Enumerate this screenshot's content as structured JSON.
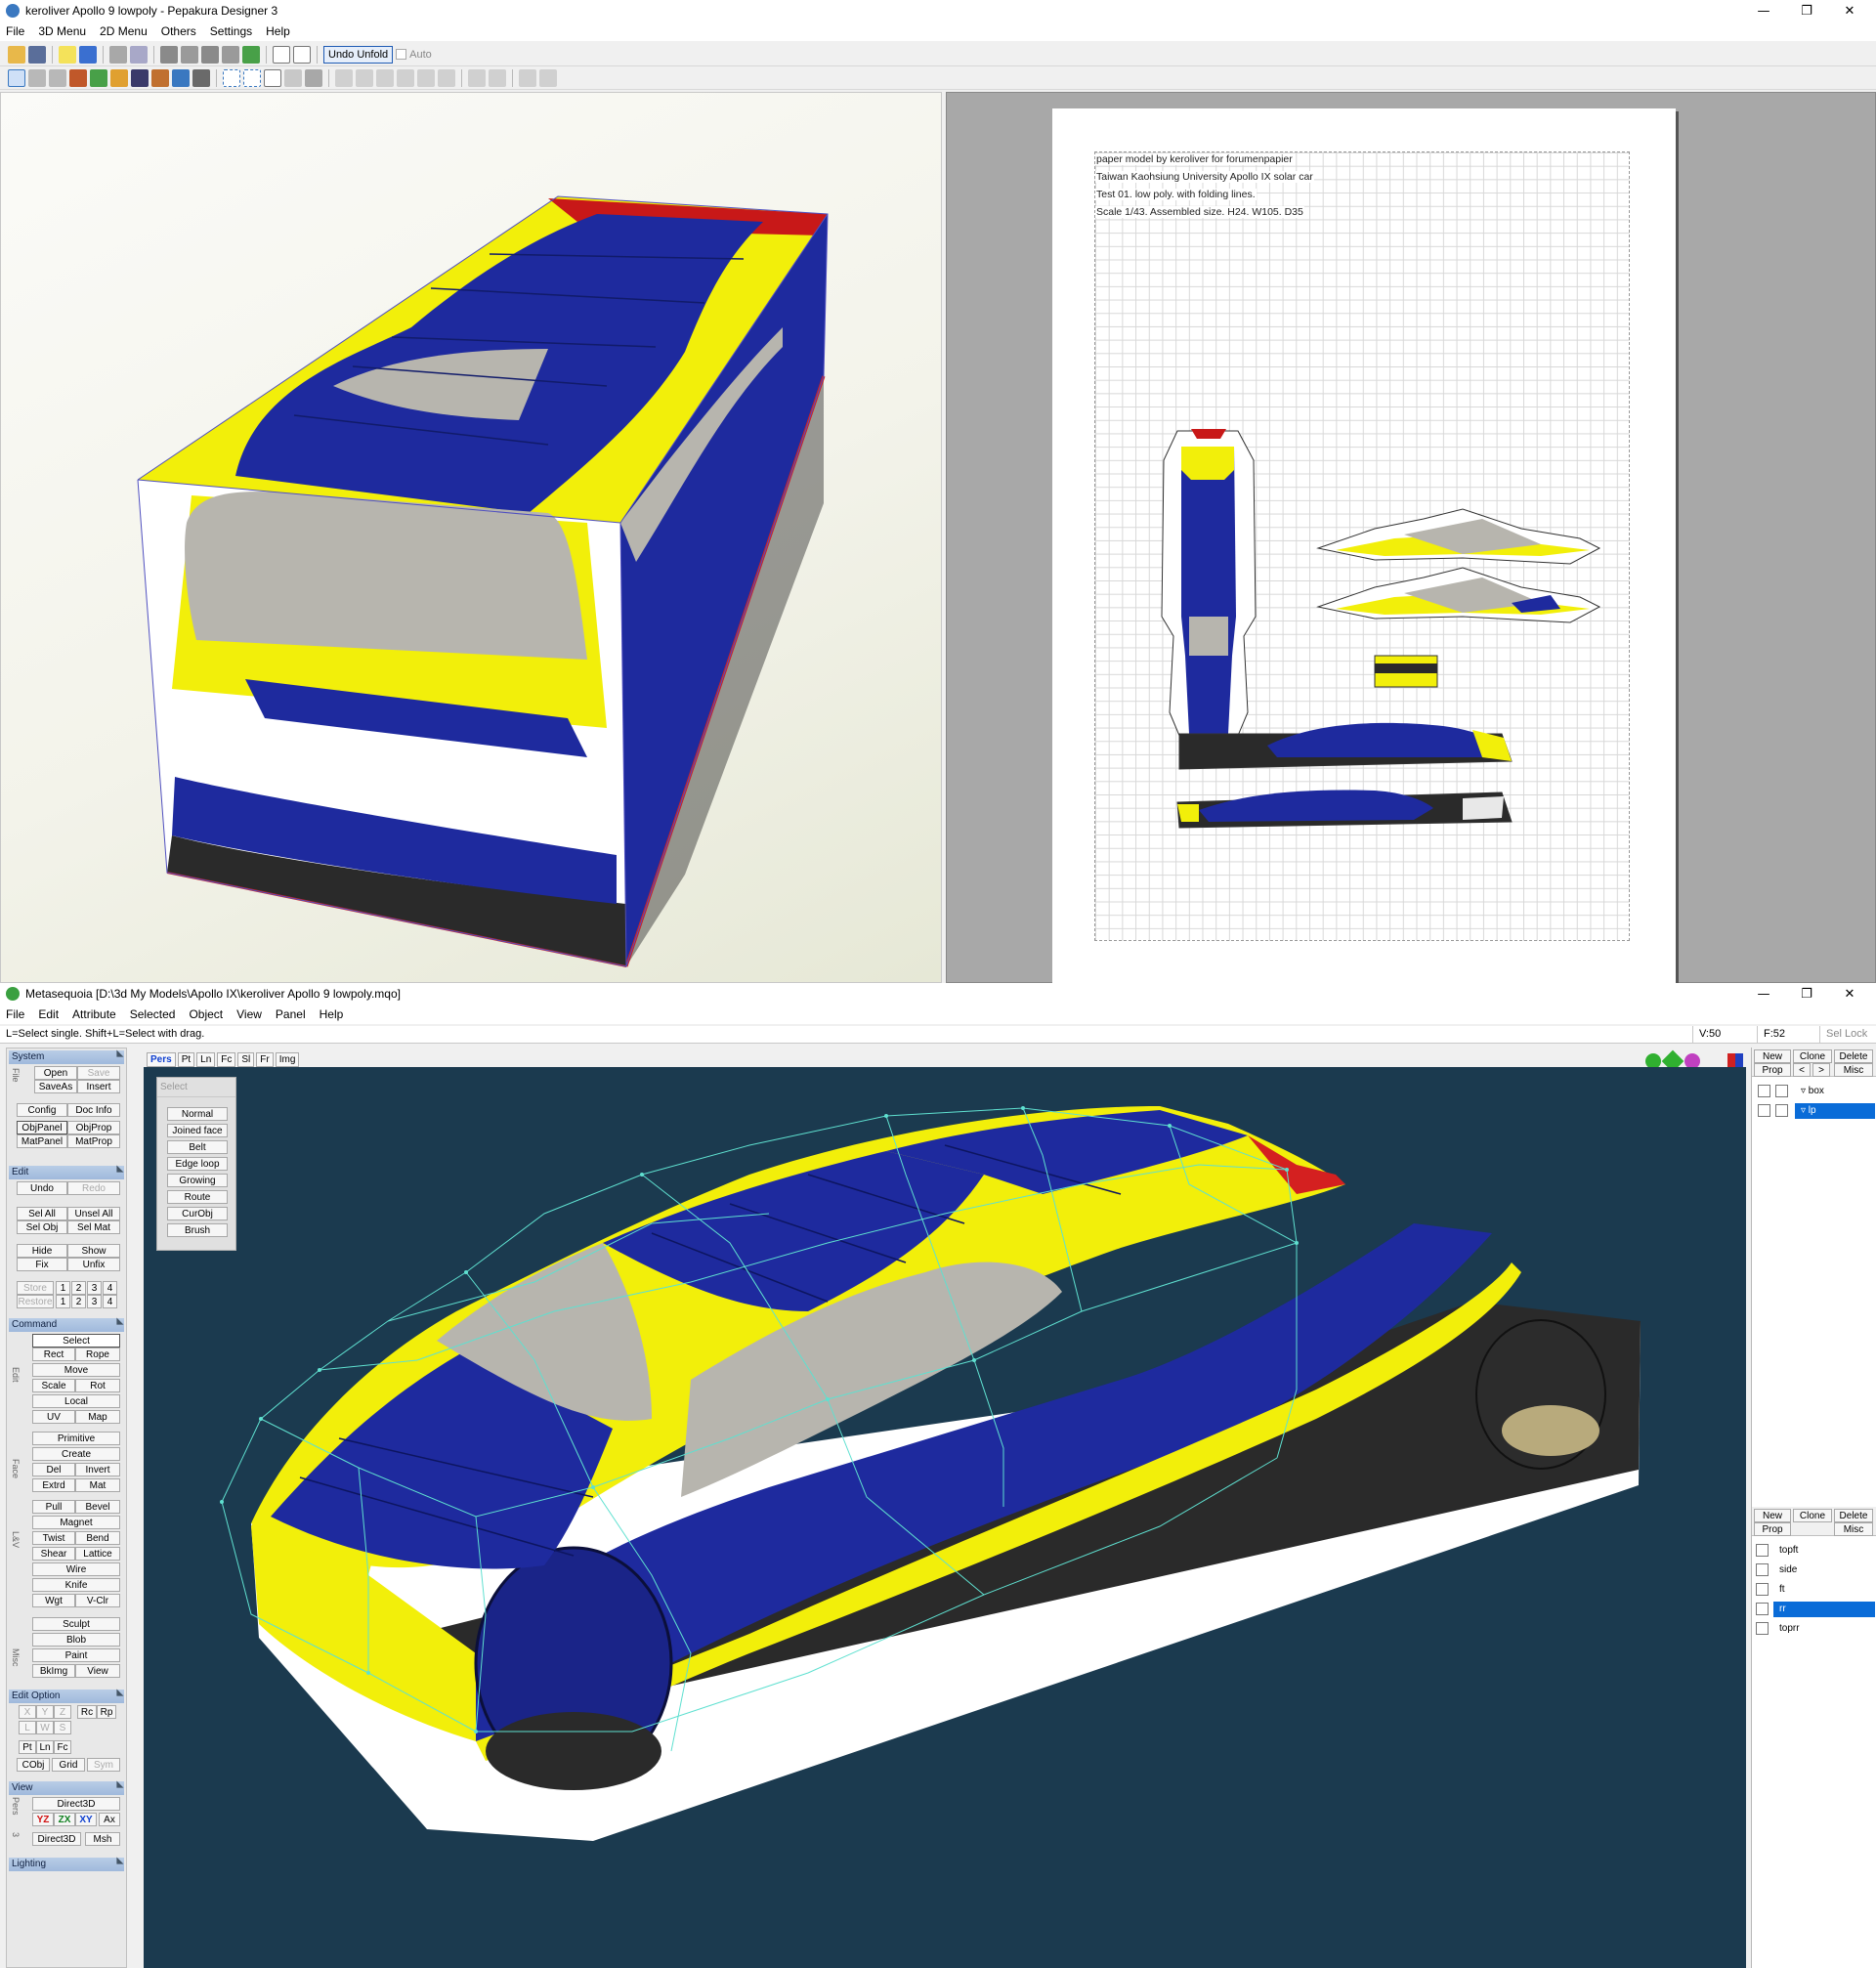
{
  "pepakura": {
    "title": "keroliver Apollo 9 lowpoly - Pepakura Designer 3",
    "menu": [
      "File",
      "3D Menu",
      "2D Menu",
      "Others",
      "Settings",
      "Help"
    ],
    "undo_unfold": "Undo Unfold",
    "auto_label": "Auto",
    "paper_text": [
      "paper model by keroliver for forumenpapier",
      "Taiwan Kaohsiung University Apollo IX solar car",
      "Test 01. low poly. with folding lines.",
      "Scale 1/43. Assembled size. H24. W105. D35"
    ]
  },
  "metasequoia": {
    "title": "Metasequoia [D:\\3d My Models\\Apollo IX\\keroliver Apollo 9 lowpoly.mqo]",
    "menu": [
      "File",
      "Edit",
      "Attribute",
      "Selected",
      "Object",
      "View",
      "Panel",
      "Help"
    ],
    "hint": "L=Select single.  Shift+L=Select with drag.",
    "v_count": "V:50",
    "f_count": "F:52",
    "sel_lock": "Sel Lock",
    "view_tabs": [
      "Pers",
      "Pt",
      "Ln",
      "Fc",
      "Sl",
      "Fr",
      "Img"
    ],
    "select_panel": {
      "title": "Select",
      "items": [
        "Normal",
        "Joined face",
        "Belt",
        "Edge loop",
        "Growing",
        "Route",
        "CurObj",
        "Brush"
      ]
    },
    "sections": {
      "system": "System",
      "edit": "Edit",
      "command": "Command",
      "edit_option": "Edit Option",
      "view": "View",
      "lighting": "Lighting"
    },
    "side_labels": {
      "file": "File",
      "edit": "Edit",
      "face": "Face",
      "lv": "L&V",
      "misc": "Misc",
      "pers": "Pers"
    },
    "system_buttons": {
      "open": "Open",
      "save": "Save",
      "saveas": "SaveAs",
      "insert": "Insert",
      "config": "Config",
      "docinfo": "Doc Info",
      "objpanel": "ObjPanel",
      "objprop": "ObjProp",
      "matpanel": "MatPanel",
      "matprop": "MatProp"
    },
    "edit_buttons": {
      "undo": "Undo",
      "redo": "Redo",
      "selall": "Sel All",
      "unselall": "Unsel All",
      "selobj": "Sel Obj",
      "selmat": "Sel Mat",
      "hide": "Hide",
      "show": "Show",
      "fix": "Fix",
      "unfix": "Unfix",
      "store": "Store",
      "restore": "Restore",
      "n1": "1",
      "n2": "2",
      "n3": "3",
      "n4": "4"
    },
    "command_buttons": {
      "select": "Select",
      "rect": "Rect",
      "rope": "Rope",
      "move": "Move",
      "scale": "Scale",
      "rot": "Rot",
      "local": "Local",
      "uv": "UV",
      "map": "Map",
      "primitive": "Primitive",
      "create": "Create",
      "del": "Del",
      "invert": "Invert",
      "extrd": "Extrd",
      "mat": "Mat",
      "pull": "Pull",
      "bevel": "Bevel",
      "magnet": "Magnet",
      "twist": "Twist",
      "bend": "Bend",
      "shear": "Shear",
      "lattice": "Lattice",
      "wire": "Wire",
      "knife": "Knife",
      "wgt": "Wgt",
      "vclr": "V-Clr",
      "sculpt": "Sculpt",
      "blob": "Blob",
      "paint": "Paint",
      "bkimg": "BkImg",
      "view": "View"
    },
    "option_buttons": {
      "x": "X",
      "y": "Y",
      "z": "Z",
      "rc": "Rc",
      "rp": "Rp",
      "l": "L",
      "w": "W",
      "s": "S",
      "pt": "Pt",
      "ln": "Ln",
      "fc": "Fc",
      "cobj": "CObj",
      "grid": "Grid",
      "sym": "Sym"
    },
    "view_buttons": {
      "direct3d": "Direct3D",
      "yz": "YZ",
      "zx": "ZX",
      "xy": "XY",
      "ax": "Ax",
      "direct3d2": "Direct3D",
      "msh": "Msh",
      "n3": "3"
    },
    "object_panel": {
      "new": "New",
      "clone": "Clone",
      "delete": "Delete",
      "prop": "Prop",
      "prev": "<",
      "next": ">",
      "misc": "Misc",
      "objects": [
        {
          "name": "box",
          "selected": false
        },
        {
          "name": "lp",
          "selected": true
        }
      ]
    },
    "material_panel": {
      "new": "New",
      "clone": "Clone",
      "delete": "Delete",
      "prop": "Prop",
      "misc": "Misc",
      "materials": [
        {
          "name": "topft",
          "selected": false
        },
        {
          "name": "side",
          "selected": false
        },
        {
          "name": "ft",
          "selected": false
        },
        {
          "name": "rr",
          "selected": true
        },
        {
          "name": "toprr",
          "selected": false
        }
      ]
    }
  },
  "colors": {
    "car_blue": "#1e2a9e",
    "car_yellow": "#f2ef0a",
    "car_grey": "#b7b5ae",
    "car_black": "#2a2a2a",
    "scene_bg": "#1b3a4f",
    "selection": "#0a6cd8"
  }
}
